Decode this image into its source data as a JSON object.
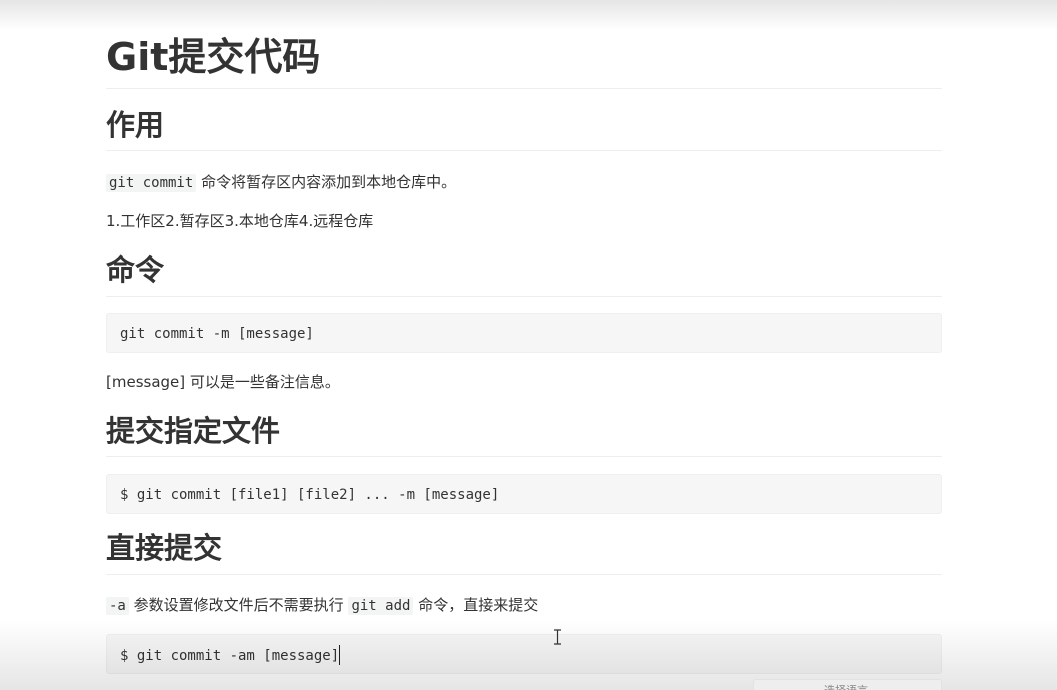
{
  "document": {
    "title": "Git提交代码",
    "sections": {
      "purpose": {
        "heading": "作用",
        "inline_code": "git commit",
        "description": "命令将暂存区内容添加到本地仓库中。",
        "areas_text": "1.工作区2.暂存区3.本地仓库4.远程仓库"
      },
      "command": {
        "heading": "命令",
        "code": "git commit -m [message]",
        "note": "[message] 可以是一些备注信息。"
      },
      "commit_files": {
        "heading": "提交指定文件",
        "code": "$ git commit [file1] [file2] ... -m [message]"
      },
      "direct_commit": {
        "heading": "直接提交",
        "flag_code": "-a",
        "text_before": "参数设置修改文件后不需要执行",
        "add_code": "git add",
        "text_after": "命令，直接来提交",
        "code": "$ git commit -am [message]"
      }
    }
  },
  "editor": {
    "language_select_label": "选择语言"
  }
}
